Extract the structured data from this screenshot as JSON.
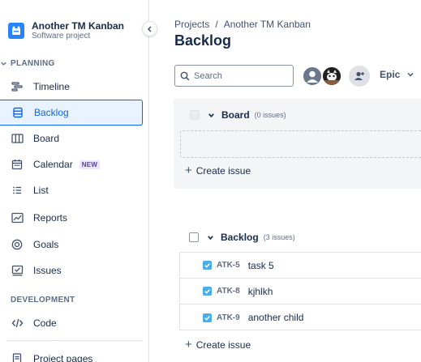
{
  "project": {
    "name": "Another TM Kanban",
    "type": "Software project"
  },
  "sidebar": {
    "planning_heading": "PLANNING",
    "development_heading": "DEVELOPMENT",
    "items": [
      {
        "label": "Timeline",
        "icon": "timeline-icon"
      },
      {
        "label": "Backlog",
        "icon": "backlog-icon",
        "active": true
      },
      {
        "label": "Board",
        "icon": "board-icon"
      },
      {
        "label": "Calendar",
        "icon": "calendar-icon",
        "badge": "NEW"
      },
      {
        "label": "List",
        "icon": "list-icon"
      },
      {
        "label": "Reports",
        "icon": "reports-icon"
      },
      {
        "label": "Goals",
        "icon": "goals-icon"
      },
      {
        "label": "Issues",
        "icon": "issues-icon"
      }
    ],
    "dev_items": [
      {
        "label": "Code",
        "icon": "code-icon"
      }
    ],
    "footer_items": [
      {
        "label": "Project pages",
        "icon": "pages-icon"
      }
    ]
  },
  "breadcrumb": {
    "root": "Projects",
    "separator": "/",
    "current": "Another TM Kanban"
  },
  "page_title": "Backlog",
  "toolbar": {
    "search_placeholder": "Search",
    "epic_label": "Epic"
  },
  "board_section": {
    "title": "Board",
    "count": "(0 issues)",
    "create_label": "Create issue"
  },
  "backlog_section": {
    "title": "Backlog",
    "count": "(3 issues)",
    "create_label": "Create issue",
    "issues": [
      {
        "key": "ATK-5",
        "summary": "task 5"
      },
      {
        "key": "ATK-8",
        "summary": "kjhlkh"
      },
      {
        "key": "ATK-9",
        "summary": "another child"
      }
    ]
  },
  "colors": {
    "accent": "#0c66e4",
    "active_bg": "#e9f2ff",
    "task_icon": "#4bade8",
    "badge_text": "#5243aa"
  }
}
